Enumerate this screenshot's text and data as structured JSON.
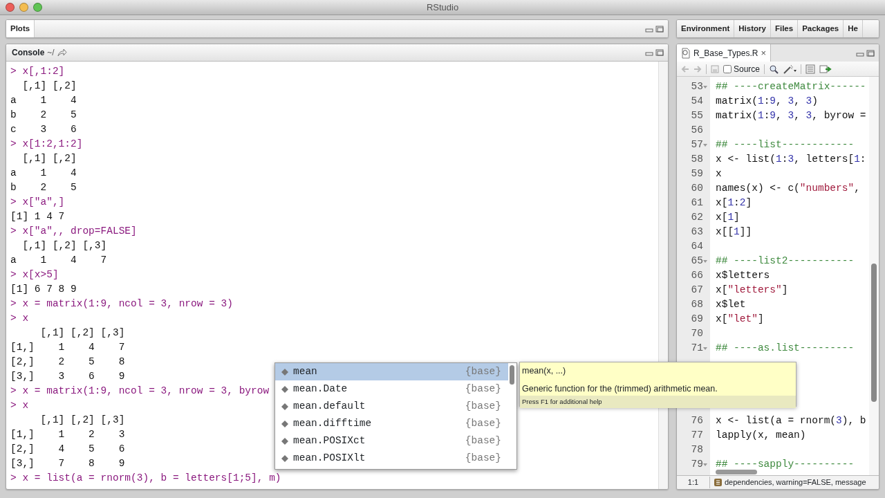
{
  "window": {
    "title": "RStudio"
  },
  "plots_pane": {
    "tabs": [
      {
        "label": "Plots",
        "selected": true
      }
    ]
  },
  "console": {
    "title": "Console",
    "path": "~/",
    "lines": [
      {
        "kind": "input",
        "text": "> x[,1:2]"
      },
      {
        "kind": "output",
        "text": "  [,1] [,2]"
      },
      {
        "kind": "output",
        "text": "a    1    4"
      },
      {
        "kind": "output",
        "text": "b    2    5"
      },
      {
        "kind": "output",
        "text": "c    3    6"
      },
      {
        "kind": "input",
        "text": "> x[1:2,1:2]"
      },
      {
        "kind": "output",
        "text": "  [,1] [,2]"
      },
      {
        "kind": "output",
        "text": "a    1    4"
      },
      {
        "kind": "output",
        "text": "b    2    5"
      },
      {
        "kind": "input",
        "text": "> x[\"a\",]"
      },
      {
        "kind": "output",
        "text": "[1] 1 4 7"
      },
      {
        "kind": "input",
        "text": "> x[\"a\",, drop=FALSE]"
      },
      {
        "kind": "output",
        "text": "  [,1] [,2] [,3]"
      },
      {
        "kind": "output",
        "text": "a    1    4    7"
      },
      {
        "kind": "input",
        "text": "> x[x>5]"
      },
      {
        "kind": "output",
        "text": "[1] 6 7 8 9"
      },
      {
        "kind": "input",
        "text": "> x = matrix(1:9, ncol = 3, nrow = 3)"
      },
      {
        "kind": "input",
        "text": "> x"
      },
      {
        "kind": "output",
        "text": "     [,1] [,2] [,3]"
      },
      {
        "kind": "output",
        "text": "[1,]    1    4    7"
      },
      {
        "kind": "output",
        "text": "[2,]    2    5    8"
      },
      {
        "kind": "output",
        "text": "[3,]    3    6    9"
      },
      {
        "kind": "input",
        "text": "> x = matrix(1:9, ncol = 3, nrow = 3, byrow"
      },
      {
        "kind": "input",
        "text": "> x"
      },
      {
        "kind": "output",
        "text": "     [,1] [,2] [,3]"
      },
      {
        "kind": "output",
        "text": "[1,]    1    2    3"
      },
      {
        "kind": "output",
        "text": "[2,]    4    5    6"
      },
      {
        "kind": "output",
        "text": "[3,]    7    8    9"
      },
      {
        "kind": "input",
        "text": "> x = list(a = rnorm(3), b = letters[1;5], m)"
      }
    ]
  },
  "completion": {
    "items": [
      {
        "name": "mean",
        "package": "{base}",
        "selected": true
      },
      {
        "name": "mean.Date",
        "package": "{base}",
        "selected": false
      },
      {
        "name": "mean.default",
        "package": "{base}",
        "selected": false
      },
      {
        "name": "mean.difftime",
        "package": "{base}",
        "selected": false
      },
      {
        "name": "mean.POSIXct",
        "package": "{base}",
        "selected": false
      },
      {
        "name": "mean.POSIXlt",
        "package": "{base}",
        "selected": false
      }
    ]
  },
  "tooltip": {
    "signature": "mean(x, ...)",
    "description": "Generic function for the (trimmed) arithmetic mean.",
    "hint": "Press F1 for additional help"
  },
  "right_tabs": [
    {
      "label": "Environment",
      "selected": false
    },
    {
      "label": "History",
      "selected": false
    },
    {
      "label": "Files",
      "selected": false
    },
    {
      "label": "Packages",
      "selected": false
    },
    {
      "label": "He",
      "selected": false
    }
  ],
  "editor": {
    "file_tab": {
      "label": "R_Base_Types.R",
      "close": "×"
    },
    "source_on_save": {
      "label": "Source",
      "checked": false
    },
    "lines": [
      {
        "kind": "code",
        "num": "53",
        "code": "## ----createMatrix------",
        "fold": true
      },
      {
        "kind": "code",
        "num": "54",
        "code": "matrix(1:9, 3, 3)"
      },
      {
        "kind": "code",
        "num": "55",
        "code": "matrix(1:9, 3, 3, byrow ="
      },
      {
        "kind": "code",
        "num": "56"
      },
      {
        "kind": "code",
        "num": "57",
        "code": "## ----list------------",
        "fold": true
      },
      {
        "kind": "code",
        "num": "58",
        "code": "x <- list(1:3, letters[1:"
      },
      {
        "kind": "code",
        "num": "59",
        "code": "x"
      },
      {
        "kind": "code",
        "num": "60",
        "code": "names(x) <- c(\"numbers\","
      },
      {
        "kind": "code",
        "num": "61",
        "code": "x[1:2]"
      },
      {
        "kind": "code",
        "num": "62",
        "code": "x[1]"
      },
      {
        "kind": "code",
        "num": "63",
        "code": "x[[1]]"
      },
      {
        "kind": "code",
        "num": "64"
      },
      {
        "kind": "code",
        "num": "65",
        "code": "## ----list2-----------",
        "fold": true
      },
      {
        "kind": "code",
        "num": "66",
        "code": "x$letters"
      },
      {
        "kind": "code",
        "num": "67",
        "code": "x[\"letters\"]"
      },
      {
        "kind": "code",
        "num": "68",
        "code": "x$let"
      },
      {
        "kind": "code",
        "num": "69",
        "code": "x[\"let\"]"
      },
      {
        "kind": "code",
        "num": "70"
      },
      {
        "kind": "code",
        "num": "71",
        "code": "## ----as.list---------",
        "fold": true
      },
      {
        "kind": "covered"
      },
      {
        "kind": "covered"
      },
      {
        "kind": "covered"
      },
      {
        "kind": "covered"
      },
      {
        "kind": "code",
        "num": "76",
        "code": "x <- list(a = rnorm(3), b"
      },
      {
        "kind": "code",
        "num": "77",
        "code": "lapply(x, mean)"
      },
      {
        "kind": "code",
        "num": "78"
      },
      {
        "kind": "code",
        "num": "79",
        "code": "## ----sapply----------",
        "fold": true
      }
    ],
    "status": {
      "position": "1:1",
      "chunk": "dependencies, warning=FALSE, message"
    }
  }
}
